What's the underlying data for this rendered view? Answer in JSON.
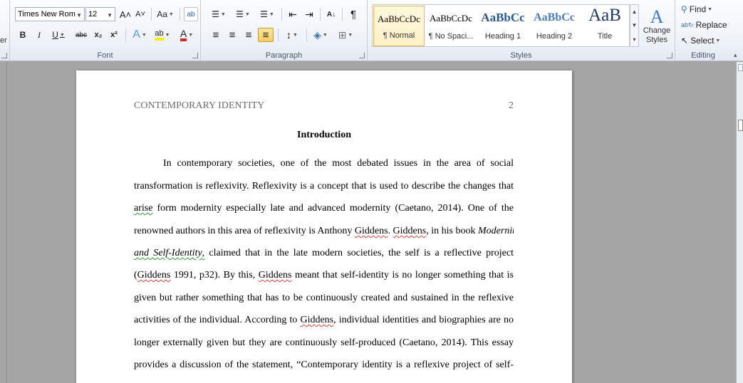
{
  "ribbon": {
    "clipboard_fragment": "er",
    "font_group": {
      "label": "Font",
      "font_name": "Times New Rom",
      "font_size": "12",
      "grow_font": "A˄",
      "shrink_font": "A˅",
      "change_case": "Aa",
      "clear_format": "ab",
      "bold": "B",
      "italic": "I",
      "underline": "U",
      "strikethrough": "abc",
      "subscript": "x₂",
      "superscript": "x²",
      "text_effects": "A",
      "highlight": "ab",
      "font_color": "A",
      "highlight_color": "#f8f000",
      "font_color_value": "#e52020"
    },
    "paragraph_group": {
      "label": "Paragraph",
      "bullets": "☰",
      "numbering": "☰",
      "multilevel": "☰",
      "decrease_indent": "⇤",
      "increase_indent": "⇥",
      "sort": "A↓",
      "show_marks": "¶",
      "align_left": "≡",
      "align_center": "≡",
      "align_right": "≡",
      "justify": "≡",
      "line_spacing": "↕",
      "shading": "◈",
      "borders": "⊞"
    },
    "styles_group": {
      "label": "Styles",
      "items": [
        {
          "sample": "AaBbCcDc",
          "name": "¶ Normal"
        },
        {
          "sample": "AaBbCcDc",
          "name": "¶ No Spaci..."
        },
        {
          "sample": "AaBbCc",
          "name": "Heading 1"
        },
        {
          "sample": "AaBbCc",
          "name": "Heading 2"
        },
        {
          "sample": "AaB",
          "name": "Title"
        }
      ],
      "change_styles_line1": "Change",
      "change_styles_line2": "Styles"
    },
    "editing_group": {
      "label": "Editing",
      "find": "Find",
      "replace": "Replace",
      "select": "Select"
    }
  },
  "document": {
    "running_head": "CONTEMPORARY IDENTITY",
    "page_number": "2",
    "title": "Introduction",
    "lines": {
      "l1": "In contemporary societies, one of the most debated issues in the area of social",
      "l2": "transformation is reflexivity. Reflexivity is a concept that is used to describe the changes that",
      "l3a": "arise",
      "l3b": " form modernity especially late and advanced modernity (Caetano, 2014). One of the",
      "l4a": "renowned authors in this area of reflexivity is Anthony ",
      "l4b": "Giddens",
      "l4c": ". ",
      "l4d": "Giddens",
      "l4e": ", in his book ",
      "l4f": "Modernity",
      "l5a": "and Self-Identity",
      "l5b": ",",
      "l5c": " claimed that in the late modern societies, the self is a reflective project",
      "l6a": "(",
      "l6b": "Giddens",
      "l6c": " 1991, p32). By this, ",
      "l6d": "Giddens",
      "l6e": " meant that self-identity is no longer something that is",
      "l7": "given but rather something that has to be continuously created and sustained in the reflexive",
      "l8a": "activities of the individual. According to ",
      "l8b": "Giddens",
      "l8c": ", individual identities and biographies are no",
      "l9": "longer externally given but they are continuously self-produced (Caetano, 2014). This essay",
      "l10": "provides a discussion of the statement, “Contemporary identity is a reflexive project of self-"
    }
  },
  "colors": {
    "spell_error": "#e04040",
    "grammar_error": "#2a9a3a",
    "selected_style": "#f9cc5b"
  }
}
